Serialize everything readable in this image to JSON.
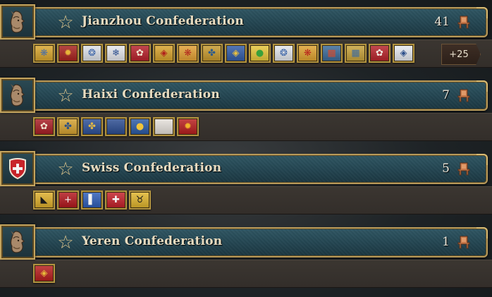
{
  "colors": {
    "banner": "#244652",
    "gold": "#b89a5a",
    "strip": "#363130"
  },
  "groups": [
    {
      "title": "Jianzhou Confederation",
      "count": "41",
      "emblem": "warrior-head-icon",
      "more_label": "+25",
      "flags": [
        {
          "bg": "#d9a62c",
          "fg": "#4a6fa5",
          "sym": "❋"
        },
        {
          "bg": "#a8201c",
          "fg": "#e8b43a",
          "sym": "✹"
        },
        {
          "bg": "#dfe3ea",
          "fg": "#3a63a8",
          "sym": "❂"
        },
        {
          "bg": "#e6e8ee",
          "fg": "#2e4f8f",
          "sym": "❄"
        },
        {
          "bg": "#b8202a",
          "fg": "#f0e4d0",
          "sym": "✿"
        },
        {
          "bg": "#d8a22a",
          "fg": "#b0201c",
          "sym": "◈"
        },
        {
          "bg": "#e4a032",
          "fg": "#b22a1e",
          "sym": "❋"
        },
        {
          "bg": "#c89a2c",
          "fg": "#2c5a8a",
          "sym": "✤"
        },
        {
          "bg": "#2f5aa8",
          "fg": "#e8c040",
          "sym": "◈"
        },
        {
          "bg": "#e8c83a",
          "fg": "#3aa03a",
          "sym": "●"
        },
        {
          "bg": "#e4e8ee",
          "fg": "#3a64a8",
          "sym": "❂"
        },
        {
          "bg": "#e0a22e",
          "fg": "#b8241c",
          "sym": "❋"
        },
        {
          "bg": "#3a6a9a",
          "fg": "#d84a2a",
          "sym": "▦"
        },
        {
          "bg": "#c8a23a",
          "fg": "#3a6aa0",
          "sym": "▦"
        },
        {
          "bg": "#b8222a",
          "fg": "#f0e8e0",
          "sym": "✿"
        },
        {
          "bg": "#e8ecf2",
          "fg": "#2c4f8a",
          "sym": "◈"
        }
      ]
    },
    {
      "title": "Haixi Confederation",
      "count": "7",
      "emblem": "warrior-head-icon",
      "more_label": "",
      "flags": [
        {
          "bg": "#a81c24",
          "fg": "#f0e4d0",
          "sym": "✿"
        },
        {
          "bg": "#d6a230",
          "fg": "#2a4f86",
          "sym": "✤"
        },
        {
          "bg": "#2c5098",
          "fg": "#e2b844",
          "sym": "✤"
        },
        {
          "bg": "#2a4c92",
          "fg": "#7a98c8",
          "sym": ""
        },
        {
          "bg": "#2a5aa6",
          "fg": "#f0c43a",
          "sym": "●"
        },
        {
          "bg": "#e6e2dc",
          "fg": "#c0303a",
          "sym": ""
        },
        {
          "bg": "#b81c1c",
          "fg": "#f2b42a",
          "sym": "✹"
        }
      ]
    },
    {
      "title": "Swiss Confederation",
      "count": "5",
      "emblem": "swiss-shield-icon",
      "more_label": "",
      "flags": [
        {
          "bg": "#e0b02a",
          "fg": "#1a1a1a",
          "sym": "◣"
        },
        {
          "bg": "#b4161c",
          "fg": "#f4f4f4",
          "sym": "+"
        },
        {
          "bg": "#2d5db8",
          "fg": "#f2f2f2",
          "sym": "▌"
        },
        {
          "bg": "#c42028",
          "fg": "#f4f4f4",
          "sym": "✚"
        },
        {
          "bg": "#e2b62c",
          "fg": "#1a1a1a",
          "sym": "♉"
        }
      ]
    },
    {
      "title": "Yeren Confederation",
      "count": "1",
      "emblem": "warrior-head-icon",
      "more_label": "",
      "flags": [
        {
          "bg": "#b81c1c",
          "fg": "#e8bc3a",
          "sym": "◈"
        }
      ]
    }
  ]
}
